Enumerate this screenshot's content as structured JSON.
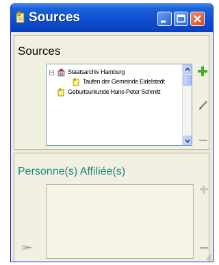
{
  "window": {
    "title": "Sources",
    "accent": "#0a45c4",
    "close_color": "#d24a22"
  },
  "sources_section": {
    "heading": "Sources",
    "tree": [
      {
        "label": "Staatsarchiv Hamburg",
        "icon": "archive-icon",
        "expanded": true,
        "level": 0
      },
      {
        "label": "Taufen der Gemeinde Eidelstedt",
        "icon": "document-icon",
        "level": 1
      },
      {
        "label": "Geburtsurkunde Hans-Peter Schmitt",
        "icon": "document-icon",
        "level": 0
      }
    ],
    "actions": [
      "add-icon",
      "edit-icon",
      "remove-icon"
    ]
  },
  "persons_section": {
    "heading": "Personne(s) Affiliée(s)",
    "heading_color": "#1a8a7a",
    "actions": [
      "add-icon",
      "remove-icon",
      "unlink-icon"
    ]
  }
}
